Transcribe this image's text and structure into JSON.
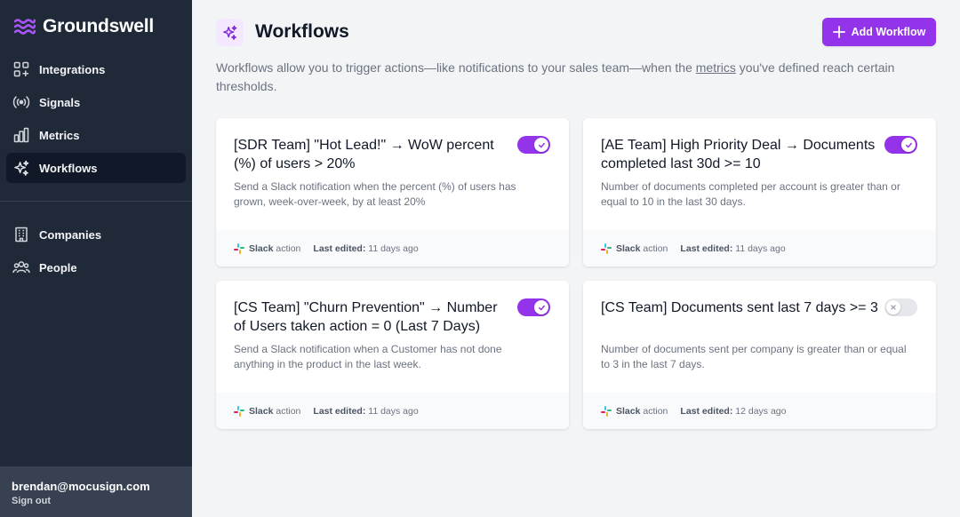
{
  "app": {
    "name": "Groundswell",
    "brand_color": "#9333ea"
  },
  "sidebar": {
    "items": [
      {
        "label": "Integrations",
        "icon": "integrations-icon",
        "active": false
      },
      {
        "label": "Signals",
        "icon": "signal-icon",
        "active": false
      },
      {
        "label": "Metrics",
        "icon": "bar-chart-icon",
        "active": false
      },
      {
        "label": "Workflows",
        "icon": "sparkles-icon",
        "active": true
      }
    ],
    "secondary_items": [
      {
        "label": "Companies",
        "icon": "building-icon"
      },
      {
        "label": "People",
        "icon": "users-icon"
      }
    ],
    "user": {
      "email": "brendan@mocusign.com",
      "sign_out": "Sign out"
    }
  },
  "header": {
    "title": "Workflows",
    "add_button": "Add Workflow",
    "description_before": "Workflows allow you to trigger actions—like notifications to your sales team—when the ",
    "description_link": "metrics",
    "description_after": " you've defined reach certain thresholds."
  },
  "workflows": [
    {
      "title": "[SDR Team] \"Hot Lead!\" → WoW percent (%) of users > 20%",
      "description": "Send a Slack notification when the percent (%) of users has grown, week-over-week, by at least 20%",
      "enabled": true,
      "action": "Slack",
      "action_suffix": "action",
      "edited_label": "Last edited:",
      "edited": "11 days ago"
    },
    {
      "title": "[AE Team] High Priority Deal → Documents completed last 30d >= 10",
      "description": "Number of documents completed per account is greater than or equal to 10 in the last 30 days.",
      "enabled": true,
      "action": "Slack",
      "action_suffix": "action",
      "edited_label": "Last edited:",
      "edited": "11 days ago"
    },
    {
      "title": "[CS Team] \"Churn Prevention\" → Number of Users taken action = 0 (Last 7 Days)",
      "description": "Send a Slack notification when a Customer has not done anything in the product in the last week.",
      "enabled": true,
      "action": "Slack",
      "action_suffix": "action",
      "edited_label": "Last edited:",
      "edited": "11 days ago"
    },
    {
      "title": "[CS Team] Documents sent last 7 days >= 3",
      "description": "Number of documents sent per company is greater than or equal to 3 in the last 7 days.",
      "enabled": false,
      "action": "Slack",
      "action_suffix": "action",
      "edited_label": "Last edited:",
      "edited": "12 days ago"
    }
  ]
}
